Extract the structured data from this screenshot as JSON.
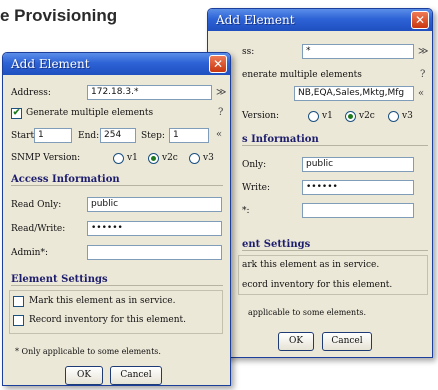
{
  "page_heading": "e Provisioning",
  "dialog_a": {
    "title": "Add Element",
    "close_glyph": "✕",
    "address_label": "Address:",
    "address_value": "172.18.3.*",
    "address_icon": "≫",
    "generate_checked_glyph": "✔",
    "generate_label": "Generate multiple elements",
    "help_glyph": "?",
    "start_label": "Start:",
    "start_value": "1",
    "end_label": "End:",
    "end_value": "254",
    "step_label": "Step:",
    "step_value": "1",
    "collapse_glyph": "«",
    "snmp_label": "SNMP Version:",
    "snmp_options": [
      "v1",
      "v2c",
      "v3"
    ],
    "access_heading": "Access Information",
    "readonly_label": "Read Only:",
    "readonly_value": "public",
    "readwrite_label": "Read/Write:",
    "readwrite_value": "••••••",
    "admin_label": "Admin*:",
    "admin_value": "",
    "element_heading": "Element Settings",
    "mark_label": "Mark this element as in service.",
    "record_label": "Record inventory for this element.",
    "footnote": "* Only applicable to some elements.",
    "ok_label": "OK",
    "cancel_label": "Cancel"
  },
  "dialog_b": {
    "title": "Add Element",
    "close_glyph": "✕",
    "address_label_partial": "ss:",
    "address_value": "*",
    "address_icon": "≫",
    "generate_label_partial": "enerate multiple elements",
    "help_glyph": "?",
    "names_value": "NB,EQA,Sales,Mktg,Mfg",
    "collapse_glyph": "«",
    "version_label_partial": "Version:",
    "snmp_options": [
      "v1",
      "v2c",
      "v3"
    ],
    "access_heading_partial": "s Information",
    "readonly_label_partial": "Only:",
    "readonly_value": "public",
    "readwrite_label_partial": "Write:",
    "readwrite_value": "••••••",
    "admin_label_partial": "*:",
    "admin_value": "",
    "element_heading_partial": "ent Settings",
    "mark_label_partial": "ark this element as in service.",
    "record_label_partial": "ecord inventory for this element.",
    "footnote_partial": "applicable to some elements.",
    "ok_label": "OK",
    "cancel_label": "Cancel"
  }
}
